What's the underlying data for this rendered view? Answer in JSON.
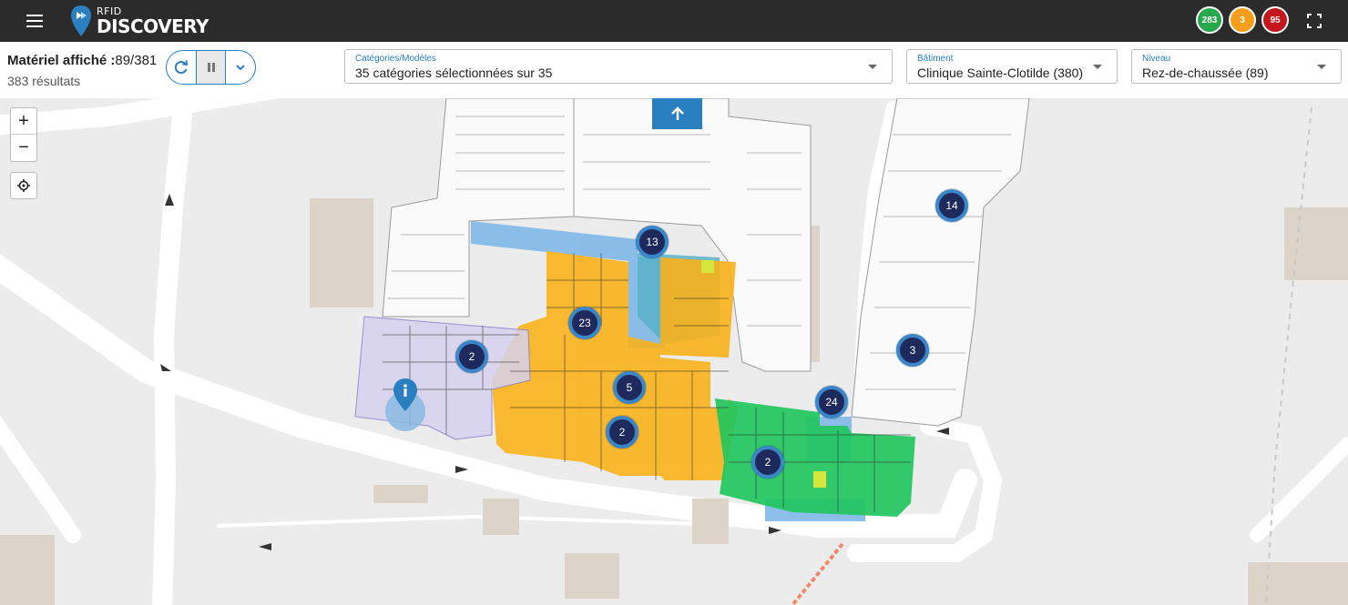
{
  "app": {
    "logo_small": "RFID",
    "logo_big": "DISCOVERY"
  },
  "badges": {
    "green": "283",
    "orange": "3",
    "red": "95"
  },
  "summary": {
    "label": "Matériel affiché :",
    "value": "89/381",
    "results": "383 résultats"
  },
  "filters": {
    "categories": {
      "label": "Catégories/Modèles",
      "value": "35 catégories sélectionnées sur 35"
    },
    "building": {
      "label": "Bâtiment",
      "value": "Clinique Sainte-Clotilde (380)"
    },
    "level": {
      "label": "Niveau",
      "value": "Rez-de-chaussée (89)"
    }
  },
  "map": {
    "zoom_in": "+",
    "zoom_out": "−",
    "clusters": [
      "13",
      "14",
      "23",
      "2",
      "3",
      "5",
      "24",
      "2",
      "2"
    ]
  },
  "colors": {
    "header": "#2b2b2b",
    "accent": "#2a7fc1",
    "zone_orange": "#f9b21b",
    "zone_green": "#22c55e",
    "zone_blue": "#7fb8e8",
    "cluster_fill": "#1f2a5c"
  },
  "icons": [
    "menu-icon",
    "logo-icon",
    "fullscreen-icon",
    "refresh-icon",
    "pause-icon",
    "chevron-down-icon",
    "arrow-up-icon",
    "locate-icon",
    "info-marker-icon"
  ]
}
